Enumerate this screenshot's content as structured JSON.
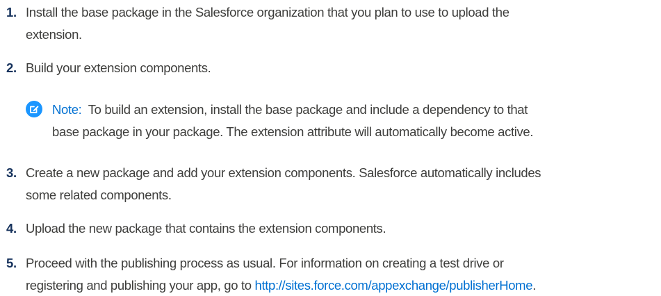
{
  "steps": [
    {
      "number": "1.",
      "line1": "Install the base package in the Salesforce organization that you plan to use to upload the",
      "line2": "extension."
    },
    {
      "number": "2.",
      "line1": "Build your extension components."
    },
    {
      "number": "3.",
      "line1": "Create a new package and add your extension components. Salesforce automatically includes",
      "line2": "some related components."
    },
    {
      "number": "4.",
      "line1": "Upload the new package that contains the extension components."
    },
    {
      "number": "5.",
      "line1": "Proceed with the publishing process as usual. For information on creating a test drive or",
      "line2_prefix": "registering and publishing your app, go to ",
      "link_text": "http://sites.force.com/appexchange/publisherHome",
      "line2_suffix": "."
    }
  ],
  "note": {
    "label": "Note:",
    "line1": "To build an extension, install the base package and include a dependency to that",
    "line2": "base package in your package. The extension attribute will automatically become active.",
    "icon": "note-edit-icon"
  },
  "colors": {
    "text": "#3e3e3c",
    "number": "#16325c",
    "accent": "#0070d2",
    "note_icon": "#1b96ff"
  }
}
